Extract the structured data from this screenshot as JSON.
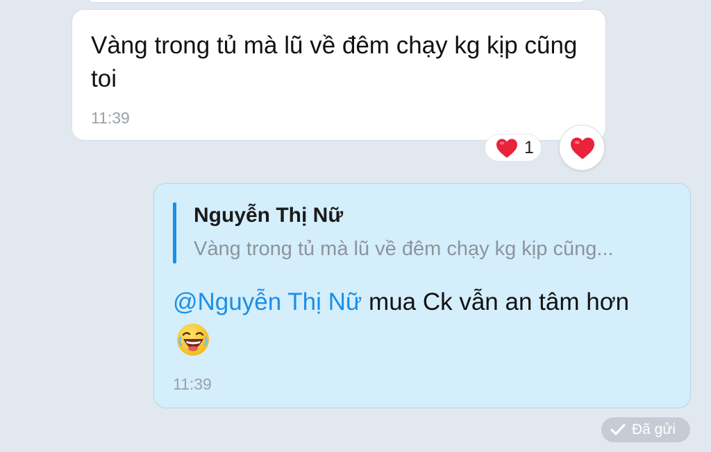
{
  "colors": {
    "background": "#e2e8ef",
    "incoming_bubble": "#ffffff",
    "outgoing_bubble": "#d4eefc",
    "accent": "#1a8fe8",
    "heart": "#e8233b",
    "timestamp": "#9aa1a8"
  },
  "incoming_message": {
    "text": "Vàng trong tủ mà lũ về đêm chạy kg kịp cũng toi",
    "time": "11:39",
    "reaction": {
      "icon": "heart-icon",
      "count": "1"
    }
  },
  "react_button": {
    "icon": "heart-icon"
  },
  "outgoing_message": {
    "quote": {
      "name": "Nguyễn Thị Nữ",
      "text": "Vàng trong tủ mà lũ về đêm chạy kg kịp cũng..."
    },
    "mention": "@Nguyễn Thị Nữ",
    "text": " mua Ck vẫn an tâm hơn",
    "emoji": "laughing-face-icon",
    "time": "11:39"
  },
  "status": {
    "icon": "check-icon",
    "label": "Đã gửi"
  }
}
